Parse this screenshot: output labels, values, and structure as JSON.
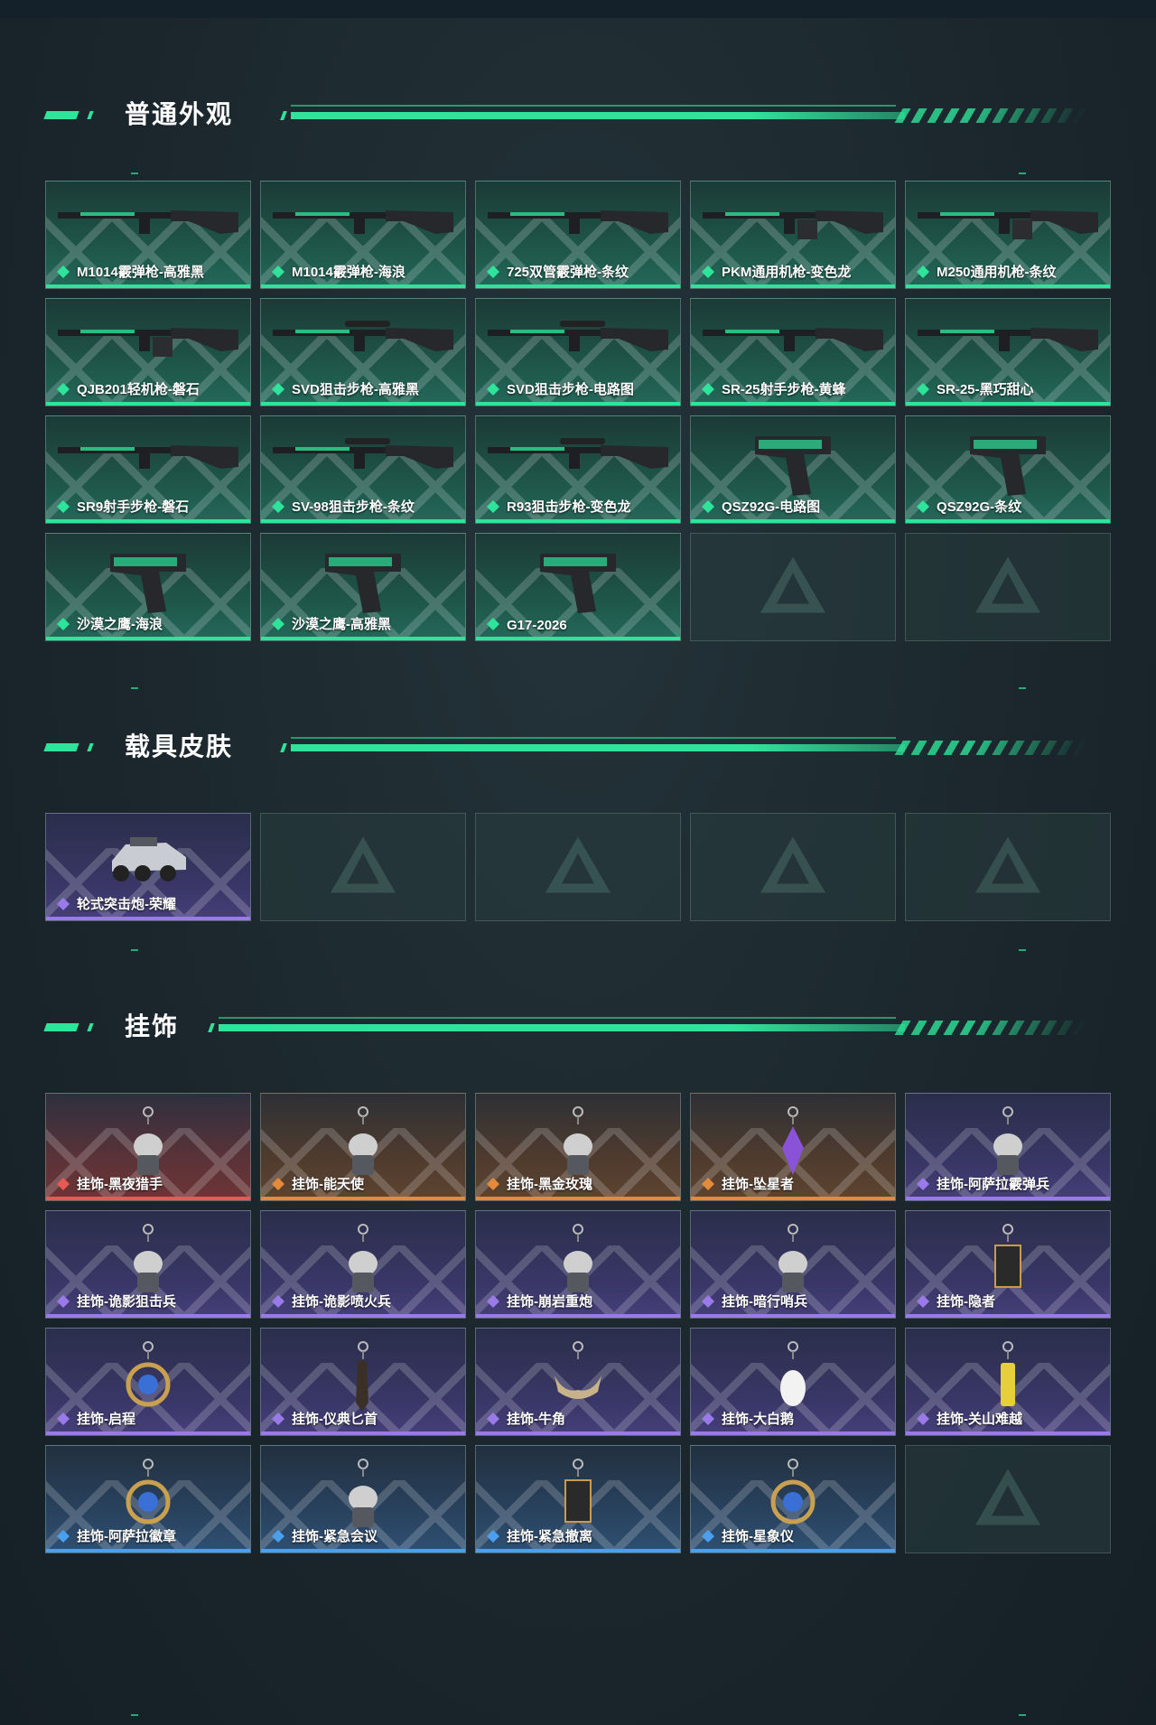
{
  "sections": [
    {
      "title": "普通外观",
      "items": [
        {
          "label": "M1014霰弹枪-高雅黑",
          "rarity": "green",
          "icon": "shotgun-black-icon"
        },
        {
          "label": "M1014霰弹枪-海浪",
          "rarity": "green",
          "icon": "shotgun-wave-icon"
        },
        {
          "label": "725双管霰弹枪-条纹",
          "rarity": "green",
          "icon": "double-barrel-shotgun-icon"
        },
        {
          "label": "PKM通用机枪-变色龙",
          "rarity": "green",
          "icon": "machine-gun-icon"
        },
        {
          "label": "M250通用机枪-条纹",
          "rarity": "green",
          "icon": "machine-gun-icon"
        },
        {
          "label": "QJB201轻机枪-磐石",
          "rarity": "green",
          "icon": "light-machine-gun-icon"
        },
        {
          "label": "SVD狙击步枪-高雅黑",
          "rarity": "green",
          "icon": "sniper-rifle-icon"
        },
        {
          "label": "SVD狙击步枪-电路图",
          "rarity": "green",
          "icon": "sniper-rifle-icon"
        },
        {
          "label": "SR-25射手步枪-黄蜂",
          "rarity": "green",
          "icon": "marksman-rifle-icon"
        },
        {
          "label": "SR-25-黑巧甜心",
          "rarity": "green",
          "icon": "marksman-rifle-icon"
        },
        {
          "label": "SR9射手步枪-磐石",
          "rarity": "green",
          "icon": "marksman-rifle-icon"
        },
        {
          "label": "SV-98狙击步枪-条纹",
          "rarity": "green",
          "icon": "sniper-rifle-icon"
        },
        {
          "label": "R93狙击步枪-变色龙",
          "rarity": "green",
          "icon": "sniper-rifle-icon"
        },
        {
          "label": "QSZ92G-电路图",
          "rarity": "green",
          "icon": "pistol-icon"
        },
        {
          "label": "QSZ92G-条纹",
          "rarity": "green",
          "icon": "pistol-icon"
        },
        {
          "label": "沙漠之鹰-海浪",
          "rarity": "green",
          "icon": "desert-eagle-icon"
        },
        {
          "label": "沙漠之鹰-高雅黑",
          "rarity": "green",
          "icon": "desert-eagle-icon"
        },
        {
          "label": "G17-2026",
          "rarity": "green",
          "icon": "pistol-icon"
        },
        {
          "label": "",
          "rarity": "empty",
          "icon": "placeholder-logo-icon"
        },
        {
          "label": "",
          "rarity": "empty",
          "icon": "placeholder-logo-icon"
        }
      ]
    },
    {
      "title": "载具皮肤",
      "items": [
        {
          "label": "轮式突击炮-荣耀",
          "rarity": "purple",
          "icon": "vehicle-icon"
        },
        {
          "label": "",
          "rarity": "empty",
          "icon": "placeholder-logo-icon"
        },
        {
          "label": "",
          "rarity": "empty",
          "icon": "placeholder-logo-icon"
        },
        {
          "label": "",
          "rarity": "empty",
          "icon": "placeholder-logo-icon"
        },
        {
          "label": "",
          "rarity": "empty",
          "icon": "placeholder-logo-icon"
        }
      ]
    },
    {
      "title": "挂饰",
      "items": [
        {
          "label": "挂饰-黑夜猎手",
          "rarity": "red",
          "icon": "charm-icon"
        },
        {
          "label": "挂饰-能天使",
          "rarity": "orange",
          "icon": "charm-icon"
        },
        {
          "label": "挂饰-黑金玫瑰",
          "rarity": "orange",
          "icon": "charm-icon"
        },
        {
          "label": "挂饰-坠星者",
          "rarity": "orange",
          "icon": "charm-crystal-icon"
        },
        {
          "label": "挂饰-阿萨拉霰弹兵",
          "rarity": "purple",
          "icon": "charm-icon"
        },
        {
          "label": "挂饰-诡影狙击兵",
          "rarity": "purple",
          "icon": "charm-icon"
        },
        {
          "label": "挂饰-诡影喷火兵",
          "rarity": "purple",
          "icon": "charm-icon"
        },
        {
          "label": "挂饰-崩岩重炮",
          "rarity": "purple",
          "icon": "charm-icon"
        },
        {
          "label": "挂饰-暗行哨兵",
          "rarity": "purple",
          "icon": "charm-icon"
        },
        {
          "label": "挂饰-隐者",
          "rarity": "purple",
          "icon": "charm-card-icon"
        },
        {
          "label": "挂饰-启程",
          "rarity": "purple",
          "icon": "charm-medal-icon"
        },
        {
          "label": "挂饰-仪典匕首",
          "rarity": "purple",
          "icon": "charm-dagger-icon"
        },
        {
          "label": "挂饰-牛角",
          "rarity": "purple",
          "icon": "charm-horn-icon"
        },
        {
          "label": "挂饰-大白鹅",
          "rarity": "purple",
          "icon": "charm-goose-icon"
        },
        {
          "label": "挂饰-关山难越",
          "rarity": "purple",
          "icon": "charm-cylinder-icon"
        },
        {
          "label": "挂饰-阿萨拉徽章",
          "rarity": "blue",
          "icon": "charm-badge-icon"
        },
        {
          "label": "挂饰-紧急会议",
          "rarity": "blue",
          "icon": "charm-icon"
        },
        {
          "label": "挂饰-紧急撤离",
          "rarity": "blue",
          "icon": "charm-card-icon"
        },
        {
          "label": "挂饰-星象仪",
          "rarity": "blue",
          "icon": "charm-orb-icon"
        },
        {
          "label": "",
          "rarity": "empty",
          "icon": "placeholder-logo-icon"
        }
      ]
    }
  ],
  "colors": {
    "accent": "#2ee39a",
    "green": "#2ee39a",
    "purple": "#9a7ae8",
    "red": "#e65a55",
    "orange": "#e48a3a",
    "blue": "#4aa0ee"
  }
}
